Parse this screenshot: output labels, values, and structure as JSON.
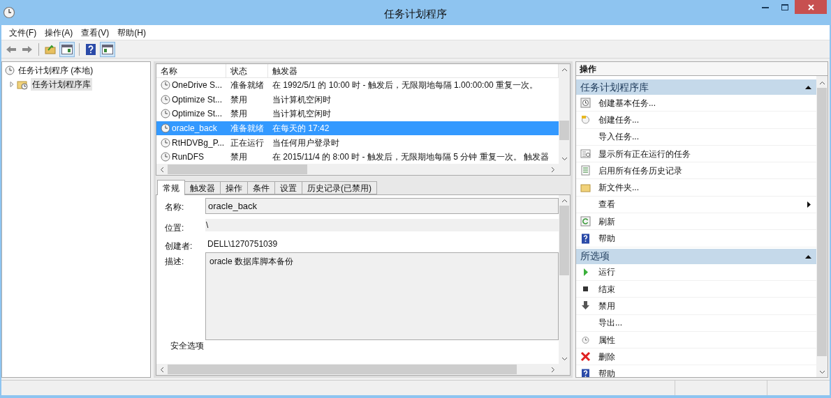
{
  "window": {
    "title": "任务计划程序"
  },
  "menu": [
    "文件(F)",
    "操作(A)",
    "查看(V)",
    "帮助(H)"
  ],
  "tree": [
    {
      "label": "任务计划程序 (本地)",
      "selected": false,
      "children": [
        {
          "label": "任务计划程序库",
          "selected": true,
          "expanded": false
        }
      ]
    }
  ],
  "task_list": {
    "columns": [
      "名称",
      "状态",
      "触发器"
    ],
    "rows": [
      {
        "name": "OneDrive S...",
        "status": "准备就绪",
        "trigger": "在 1992/5/1 的 10:00 时 - 触发后，无限期地每隔 1.00:00:00 重复一次。",
        "selected": false
      },
      {
        "name": "Optimize St...",
        "status": "禁用",
        "trigger": "当计算机空闲时",
        "selected": false
      },
      {
        "name": "Optimize St...",
        "status": "禁用",
        "trigger": "当计算机空闲时",
        "selected": false
      },
      {
        "name": "oracle_back",
        "status": "准备就绪",
        "trigger": "在每天的 17:42",
        "selected": true
      },
      {
        "name": "RtHDVBg_P...",
        "status": "正在运行",
        "trigger": "当任何用户登录时",
        "selected": false
      },
      {
        "name": "RunDFS",
        "status": "禁用",
        "trigger": "在 2015/11/4 的 8:00 时 - 触发后，无限期地每隔 5 分钟 重复一次。 触发器",
        "selected": false
      }
    ]
  },
  "details": {
    "tabs": [
      {
        "label": "常规",
        "selected": true
      },
      {
        "label": "触发器",
        "selected": false
      },
      {
        "label": "操作",
        "selected": false
      },
      {
        "label": "条件",
        "selected": false
      },
      {
        "label": "设置",
        "selected": false
      },
      {
        "label": "历史记录(已禁用)",
        "selected": false
      }
    ],
    "fields": [
      {
        "label": "名称:",
        "value": "oracle_back",
        "kind": "box"
      },
      {
        "label": "位置:",
        "value": "\\",
        "kind": "shaded"
      },
      {
        "label": "创建者:",
        "value": "DELL\\1270751039",
        "kind": "plain"
      },
      {
        "label": "描述:",
        "value": "oracle 数据库脚本备份",
        "kind": "area"
      }
    ],
    "section": "安全选项"
  },
  "actions": {
    "title": "操作",
    "groups": [
      {
        "title": "任务计划程序库",
        "items": [
          {
            "label": "创建基本任务..."
          },
          {
            "label": "创建任务..."
          },
          {
            "label": "导入任务..."
          },
          {
            "label": "显示所有正在运行的任务"
          },
          {
            "label": "启用所有任务历史记录"
          },
          {
            "label": "新文件夹..."
          },
          {
            "label": "查看",
            "submenu": true
          },
          {
            "label": "刷新"
          },
          {
            "label": "帮助"
          }
        ]
      },
      {
        "title": "所选项",
        "items": [
          {
            "label": "运行"
          },
          {
            "label": "结束"
          },
          {
            "label": "禁用"
          },
          {
            "label": "导出..."
          },
          {
            "label": "属性"
          },
          {
            "label": "删除"
          },
          {
            "label": "帮助"
          }
        ]
      }
    ]
  }
}
